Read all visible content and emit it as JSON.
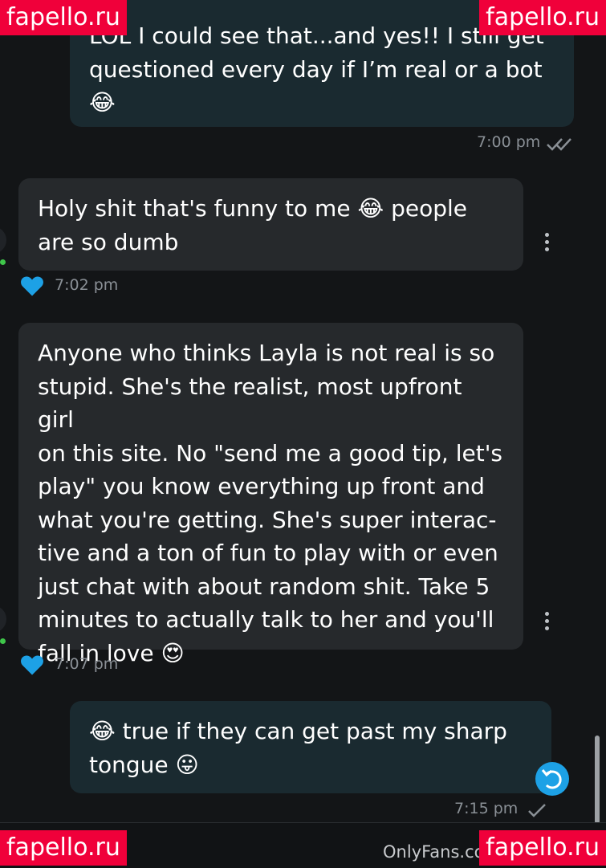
{
  "messages": [
    {
      "direction": "out",
      "text": "LOL I could see that...and yes!! I still get\nquestioned every day if I’m real or a bot\n😂",
      "time": "7:00 pm",
      "status": "read-double-check"
    },
    {
      "direction": "in",
      "text": "Holy shit that's funny to me 😂 people\nare so dumb",
      "time": "7:02 pm",
      "liked": true
    },
    {
      "direction": "in",
      "text": "Anyone who thinks Layla is not real is so\nstupid. She's the realist, most upfront girl\non this site. No \"send me a good tip, let's\nplay\" you know everything up front and\nwhat you're getting. She's super interac-\ntive and a ton of fun to play with or even\njust chat with about random shit. Take 5\nminutes to actually talk to her and you'll\nfall in love 😍",
      "time": "7:07 pm",
      "liked": true
    },
    {
      "direction": "out",
      "text": "😂 true if they can get past my sharp\ntongue 😛",
      "time": "7:15 pm",
      "status": "sent-single-check"
    }
  ],
  "watermarks": {
    "label": "fapello.ru"
  },
  "footer": {
    "site": "OnlyFans.com/"
  },
  "icons": {
    "heart": "heart-icon",
    "kebab": "more-vertical-icon",
    "undo": "undo-icon",
    "double_check": "double-check-icon",
    "check": "check-icon"
  },
  "colors": {
    "background": "#131517",
    "outgoing_bubble": "#1a2a30",
    "incoming_bubble": "#26292c",
    "heart": "#1da1e6",
    "online": "#3fc64a",
    "watermark": "#f0003a"
  }
}
